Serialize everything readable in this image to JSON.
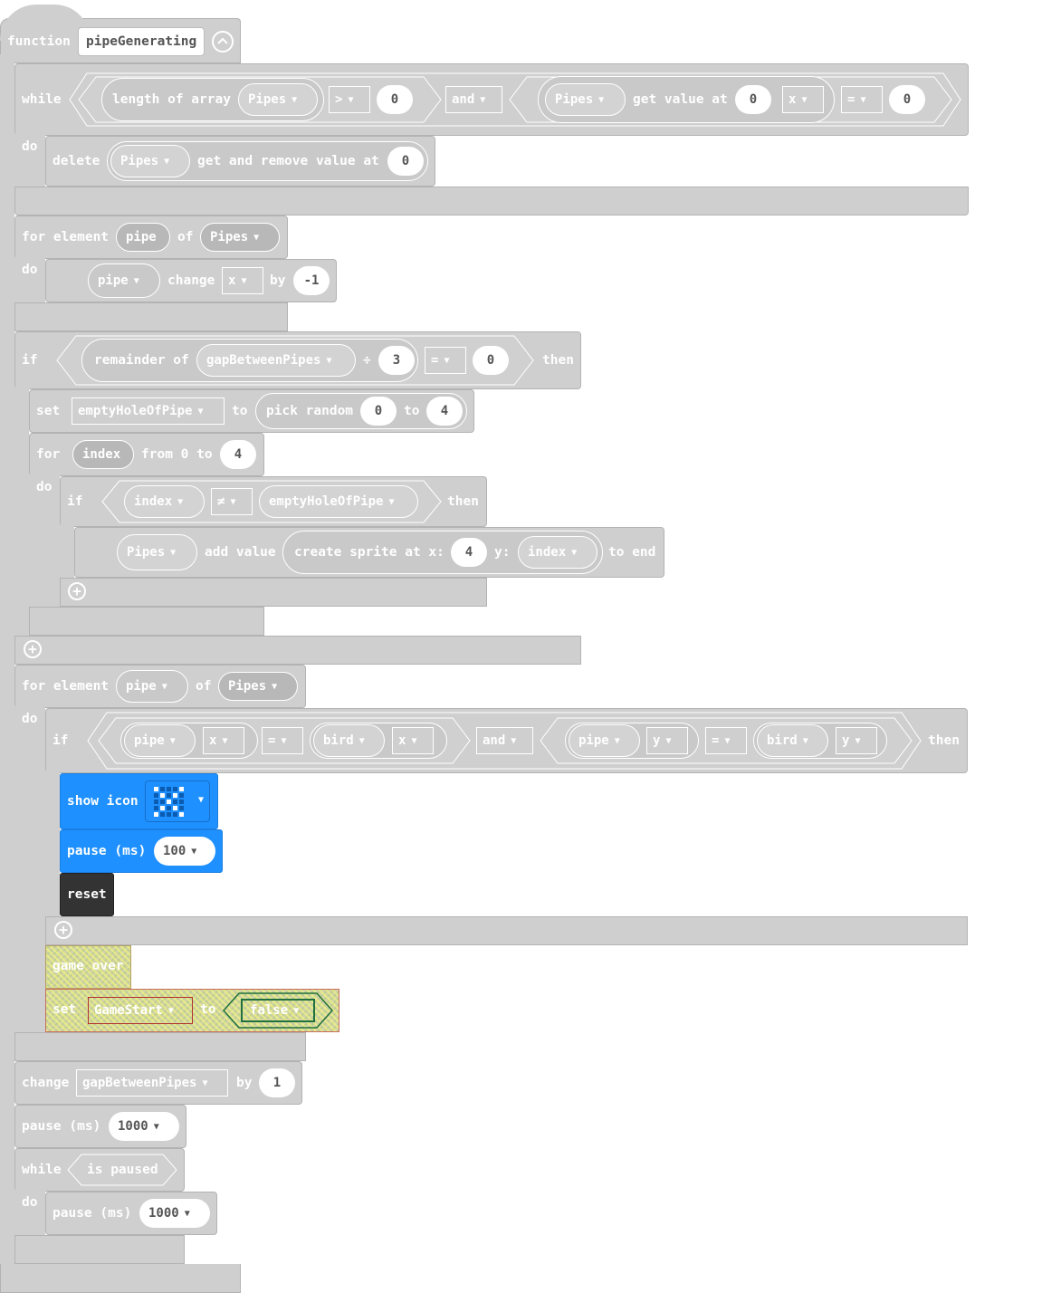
{
  "function_block": {
    "keyword": "function",
    "name": "pipeGenerating"
  },
  "while1": {
    "kw_while": "while",
    "kw_do": "do",
    "length_of_array": "length of array",
    "array1": "Pipes",
    "op1": ">",
    "val1": "0",
    "and": "and",
    "array2": "Pipes",
    "get_value_at": "get value at",
    "idx": "0",
    "prop": "x",
    "op2": "=",
    "val2": "0",
    "delete": "delete",
    "array3": "Pipes",
    "get_remove": "get and remove value at",
    "idx2": "0"
  },
  "for1": {
    "kw_for": "for element",
    "var": "pipe",
    "kw_of": "of",
    "array": "Pipes",
    "kw_do": "do",
    "sprite": "pipe",
    "change": "change",
    "prop": "x",
    "by": "by",
    "value": "-1"
  },
  "if1": {
    "kw_if": "if",
    "remainder_of": "remainder of",
    "var": "gapBetweenPipes",
    "div": "÷",
    "divisor": "3",
    "op": "=",
    "val": "0",
    "then": "then",
    "set": "set",
    "set_var": "emptyHoleOfPipe",
    "to": "to",
    "pick_random": "pick random",
    "r_from": "0",
    "r_to_kw": "to",
    "r_to": "4",
    "for": "for",
    "index": "index",
    "from_to": "from 0 to",
    "for_to": "4",
    "do": "do",
    "if2": "if",
    "index2": "index",
    "neq": "≠",
    "var2": "emptyHoleOfPipe",
    "then2": "then",
    "array": "Pipes",
    "add_value": "add value",
    "create_sprite": "create sprite at x:",
    "x_val": "4",
    "y_kw": "y:",
    "y_var": "index",
    "to_end": "to end"
  },
  "for2": {
    "kw_for": "for element",
    "var": "pipe",
    "kw_of": "of",
    "array": "Pipes",
    "kw_do": "do",
    "kw_if": "if",
    "a_sprite": "pipe",
    "a_prop": "x",
    "a_op": "=",
    "b_sprite": "bird",
    "b_prop": "x",
    "and": "and",
    "c_sprite": "pipe",
    "c_prop": "y",
    "c_op": "=",
    "d_sprite": "bird",
    "d_prop": "y",
    "then": "then",
    "show_icon": "show icon",
    "pause": "pause (ms)",
    "pause_val": "100",
    "reset": "reset",
    "game_over": "game over",
    "set": "set",
    "set_var": "GameStart",
    "to": "to",
    "bool": "false"
  },
  "tail": {
    "change": "change",
    "change_var": "gapBetweenPipes",
    "by": "by",
    "by_val": "1",
    "pause": "pause (ms)",
    "pause_val": "1000",
    "while": "while",
    "is_paused": "is paused",
    "do": "do",
    "pause2": "pause (ms)",
    "pause2_val": "1000"
  },
  "colors": {
    "block_gray": "#cfcfcf",
    "basic_blue": "#1e90ff",
    "control_dark": "#333333",
    "disabled_hatch": "#d3d3a6"
  }
}
